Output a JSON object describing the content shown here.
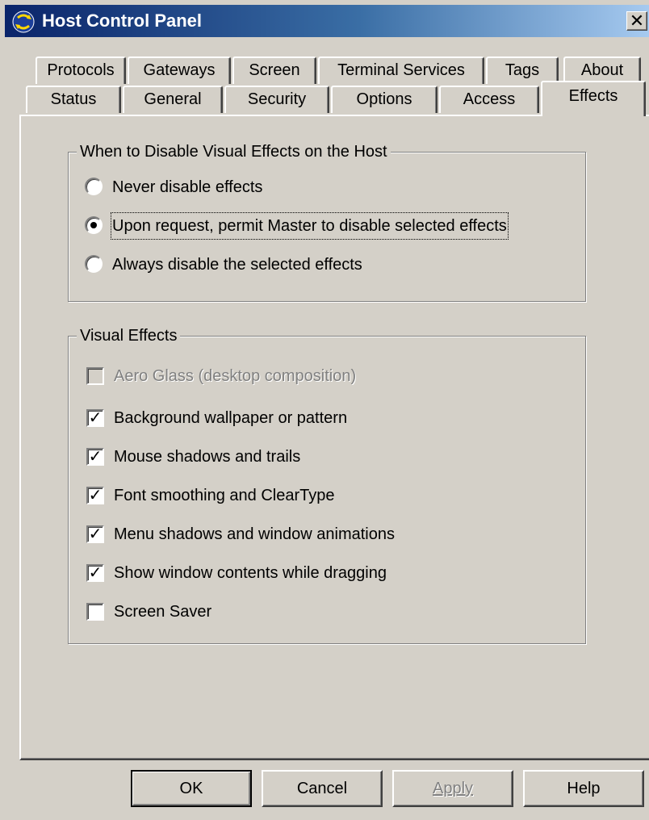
{
  "window": {
    "title": "Host Control Panel",
    "close_label": "✕"
  },
  "tabs_back_row": [
    "Protocols",
    "Gateways",
    "Screen",
    "Terminal Services",
    "Tags",
    "About"
  ],
  "tabs_front_row": [
    "Status",
    "General",
    "Security",
    "Options",
    "Access",
    "Effects"
  ],
  "selected_tab": "Effects",
  "disable_group": {
    "legend": "When to Disable Visual Effects on the Host",
    "options": [
      {
        "label": "Never disable effects",
        "selected": false
      },
      {
        "label": "Upon request, permit Master to disable selected effects",
        "selected": true
      },
      {
        "label": "Always disable the selected effects",
        "selected": false
      }
    ]
  },
  "effects_group": {
    "legend": "Visual Effects",
    "items": [
      {
        "label": "Aero Glass (desktop composition)",
        "checked": false,
        "enabled": false
      },
      {
        "label": "Background wallpaper or pattern",
        "checked": true,
        "enabled": true
      },
      {
        "label": "Mouse shadows and trails",
        "checked": true,
        "enabled": true
      },
      {
        "label": "Font smoothing and ClearType",
        "checked": true,
        "enabled": true
      },
      {
        "label": "Menu shadows and window animations",
        "checked": true,
        "enabled": true
      },
      {
        "label": "Show window contents while dragging",
        "checked": true,
        "enabled": true
      },
      {
        "label": "Screen Saver",
        "checked": false,
        "enabled": true
      }
    ]
  },
  "buttons": {
    "ok": "OK",
    "cancel": "Cancel",
    "apply": "Apply",
    "help": "Help"
  },
  "colors": {
    "face": "#d4d0c8",
    "title_start": "#0a246a",
    "title_end": "#a6caf0"
  }
}
